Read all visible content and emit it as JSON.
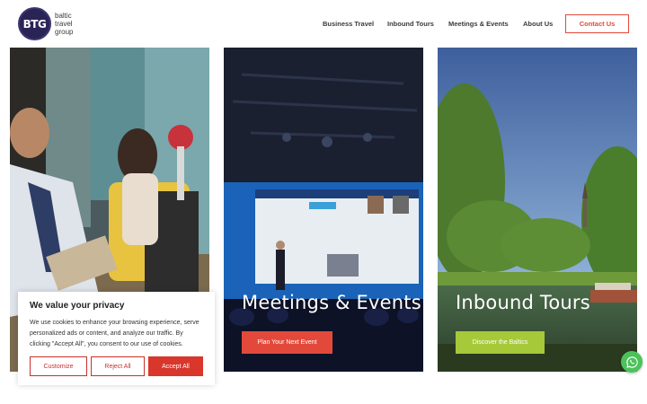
{
  "brand": {
    "badge": "BTG",
    "line1": "baltic",
    "line2": "travel",
    "line3": "group"
  },
  "nav": {
    "items": [
      "Business Travel",
      "Inbound Tours",
      "Meetings & Events",
      "About Us"
    ],
    "contact_label": "Contact Us"
  },
  "cards": [
    {
      "title": "",
      "button": ""
    },
    {
      "title": "Meetings & Events",
      "button": "Plan Your Next Event"
    },
    {
      "title": "Inbound Tours",
      "button": "Discover the Baltics"
    }
  ],
  "cookie": {
    "title": "We value your privacy",
    "text": "We use cookies to enhance your browsing experience, serve personalized ads or content, and analyze our traffic. By clicking \"Accept All\", you consent to our use of cookies.",
    "customize": "Customize",
    "reject": "Reject All",
    "accept": "Accept All"
  },
  "colors": {
    "accent": "#e2493b",
    "green": "#a6c93a",
    "brand": "#2a2456",
    "whatsapp": "#4cc25a"
  },
  "icons": {
    "chat": "whatsapp-icon"
  }
}
